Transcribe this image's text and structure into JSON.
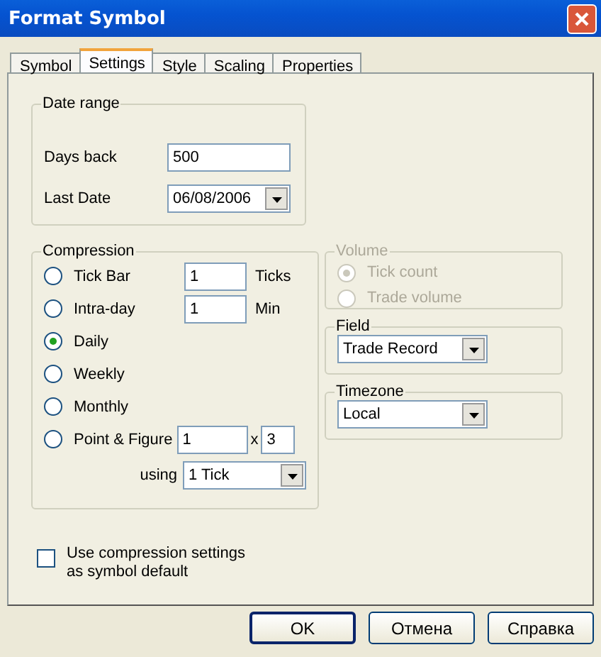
{
  "window": {
    "title": "Format Symbol"
  },
  "tabs": [
    {
      "label": "Symbol",
      "selected": false
    },
    {
      "label": "Settings",
      "selected": true
    },
    {
      "label": "Style",
      "selected": false
    },
    {
      "label": "Scaling",
      "selected": false
    },
    {
      "label": "Properties",
      "selected": false
    }
  ],
  "date_range": {
    "title": "Date range",
    "days_back": {
      "label": "Days back",
      "value": "500"
    },
    "last_date": {
      "label": "Last Date",
      "value": "06/08/2006"
    }
  },
  "compression": {
    "title": "Compression",
    "options": [
      {
        "kind": "count",
        "label": "Tick Bar",
        "selected": false,
        "value": "1",
        "unit": "Ticks"
      },
      {
        "kind": "count",
        "label": "Intra-day",
        "selected": false,
        "value": "1",
        "unit": "Min"
      },
      {
        "kind": "plain",
        "label": "Daily",
        "selected": true
      },
      {
        "kind": "plain",
        "label": "Weekly",
        "selected": false
      },
      {
        "kind": "plain",
        "label": "Monthly",
        "selected": false
      },
      {
        "kind": "pair",
        "label": "Point & Figure",
        "selected": false,
        "value": "1",
        "separator": "x",
        "value2": "3"
      }
    ],
    "using": {
      "label": "using",
      "value": "1 Tick"
    }
  },
  "volume": {
    "title": "Volume",
    "disabled": true,
    "options": [
      {
        "label": "Tick count",
        "selected": true
      },
      {
        "label": "Trade volume",
        "selected": false
      }
    ]
  },
  "field": {
    "title": "Field",
    "value": "Trade Record"
  },
  "timezone": {
    "title": "Timezone",
    "value": "Local"
  },
  "default_checkbox": {
    "label": "Use compression settings as symbol default",
    "checked": false
  },
  "buttons": [
    {
      "label": "OK",
      "default": true
    },
    {
      "label": "Отмена",
      "default": false
    },
    {
      "label": "Справка",
      "default": false
    }
  ]
}
